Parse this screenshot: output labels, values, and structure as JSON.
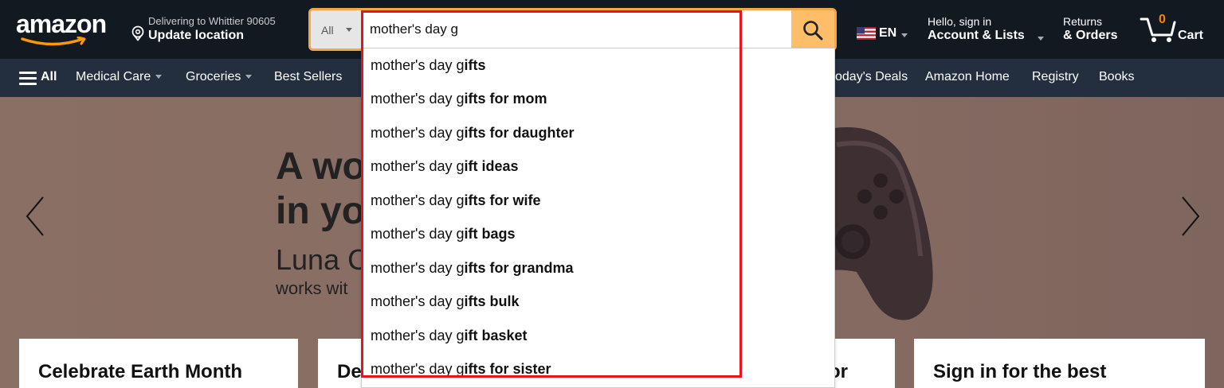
{
  "header": {
    "logo_text": "amazon",
    "location_line1": "Delivering to Whittier 90605",
    "location_line2": "Update location",
    "search": {
      "category": "All",
      "query": "mother's day g"
    },
    "language": "EN",
    "account_line1": "Hello, sign in",
    "account_line2": "Account & Lists",
    "orders_line1": "Returns",
    "orders_line2": "& Orders",
    "cart_count": "0",
    "cart_label": "Cart"
  },
  "subnav": {
    "all_label": "All",
    "items": [
      {
        "label": "Medical Care",
        "has_caret": true
      },
      {
        "label": "Groceries",
        "has_caret": true
      },
      {
        "label": "Best Sellers",
        "has_caret": false
      },
      {
        "label": "oday's Deals",
        "has_caret": false
      },
      {
        "label": "Amazon Home",
        "has_caret": false
      },
      {
        "label": "Registry",
        "has_caret": false
      },
      {
        "label": "Books",
        "has_caret": false
      }
    ]
  },
  "hero": {
    "headline_line1": "A wo",
    "headline_line2": "in yo",
    "sub_line1": "Luna C",
    "sub_line2": "works wit"
  },
  "cards": [
    {
      "title": "Celebrate Earth Month"
    },
    {
      "title": "De"
    },
    {
      "title": "or"
    },
    {
      "title": "Sign in for the best"
    }
  ],
  "suggestions": {
    "typed_prefix": "mother's day g",
    "items": [
      {
        "rest": "ifts",
        "full": "mother's day gifts"
      },
      {
        "rest": "ifts for mom",
        "full": "mother's day gifts for mom"
      },
      {
        "rest": "ifts for daughter",
        "full": "mother's day gifts for daughter"
      },
      {
        "rest": "ift ideas",
        "full": "mother's day gift ideas"
      },
      {
        "rest": "ifts for wife",
        "full": "mother's day gifts for wife"
      },
      {
        "rest": "ift bags",
        "full": "mother's day gift bags"
      },
      {
        "rest": "ifts for grandma",
        "full": "mother's day gifts for grandma"
      },
      {
        "rest": "ifts bulk",
        "full": "mother's day gifts bulk"
      },
      {
        "rest": "ift basket",
        "full": "mother's day gift basket"
      },
      {
        "rest": "ifts for sister",
        "full": "mother's day gifts for sister"
      }
    ]
  },
  "colors": {
    "topbar": "#131921",
    "subnav": "#232f3e",
    "search_button": "#febd69",
    "search_focus": "#f3a847",
    "cart_count": "#f08804",
    "annotation_box": "#e8141c"
  }
}
